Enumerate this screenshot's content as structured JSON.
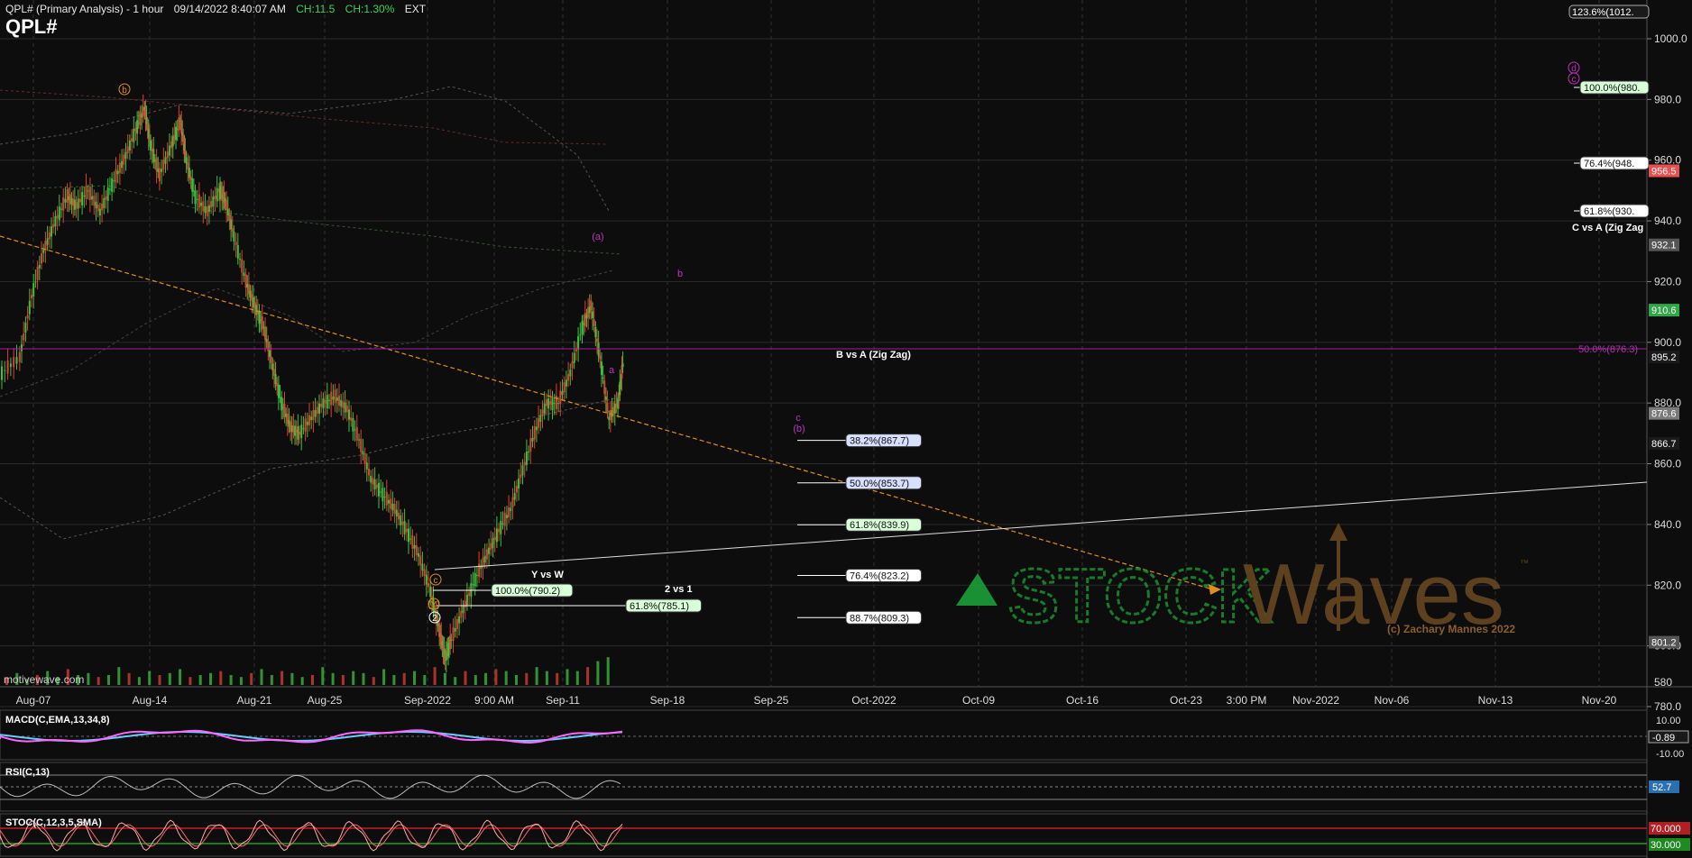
{
  "header": {
    "title": "QPL# (Primary Analysis) - 1 hour",
    "datetime": "09/14/2022 8:40:07 AM",
    "change": "CH:11.5",
    "change_pct": "CH:1.30%",
    "session": "EXT",
    "symbol": "QPL#"
  },
  "watermark": {
    "source": "motivewave.com",
    "brand_left": "STOCK",
    "brand_right": "Waves",
    "tm": "™",
    "copyright": "(c) Zachary Mannes 2022"
  },
  "colors": {
    "up": "#3fc03f",
    "down": "#e04030",
    "fib_line": "#ffffff",
    "orange": "#e0901a",
    "magenta": "#c030c0",
    "macd": "#ff66ff",
    "macd_signal": "#66ccff"
  },
  "chart_data": {
    "type": "candlestick",
    "price_axis": {
      "ticks": [
        "1000.0",
        "980.0",
        "960.0",
        "940.0",
        "920.0",
        "900.0",
        "880.0",
        "860.0",
        "840.0",
        "820.0",
        "800.0",
        "780.0",
        "580"
      ],
      "ylim": [
        771,
        1010
      ]
    },
    "price_tags": [
      {
        "text": "123.6%(1012.",
        "price": 1008,
        "color": "#1a1a1a",
        "fg": "#ffffff"
      },
      {
        "text": "956.5",
        "price": 956.5,
        "color": "#e85050",
        "fg": "#ffffff"
      },
      {
        "text": "932.1",
        "price": 932.1,
        "color": "#555555",
        "fg": "#ffffff"
      },
      {
        "text": "910.6",
        "price": 910.6,
        "color": "#2fa84a",
        "fg": "#ffffff"
      },
      {
        "text": "895.2",
        "price": 895.2,
        "color": "#1a1a1a",
        "fg": "#ffffff"
      },
      {
        "text": "876.6",
        "price": 876.6,
        "color": "#7a7a7a",
        "fg": "#ffffff"
      },
      {
        "text": "866.7",
        "price": 866.7,
        "color": "#1a1a1a",
        "fg": "#ffffff"
      },
      {
        "text": "801.2",
        "price": 801.2,
        "color": "#555555",
        "fg": "#ffffff"
      }
    ],
    "time_axis": {
      "labels": [
        "Aug-07",
        "Aug-14",
        "Aug-21",
        "Aug-25",
        "Sep-2022",
        "9:00 AM",
        "Sep-11",
        "Sep-18",
        "Sep-25",
        "Oct-2022",
        "Oct-09",
        "Oct-16",
        "Oct-23",
        "3:00 PM",
        "Nov-2022",
        "Nov-06",
        "Nov-13",
        "Nov-20"
      ]
    },
    "price_path": [
      [
        0,
        890
      ],
      [
        6,
        895
      ],
      [
        10,
        915
      ],
      [
        14,
        930
      ],
      [
        18,
        940
      ],
      [
        22,
        948
      ],
      [
        25,
        945
      ],
      [
        29,
        950
      ],
      [
        33,
        943
      ],
      [
        37,
        952
      ],
      [
        41,
        960
      ],
      [
        45,
        970
      ],
      [
        48,
        977
      ],
      [
        50,
        965
      ],
      [
        53,
        955
      ],
      [
        57,
        965
      ],
      [
        60,
        973
      ],
      [
        62,
        960
      ],
      [
        65,
        948
      ],
      [
        69,
        943
      ],
      [
        73,
        950
      ],
      [
        75,
        947
      ],
      [
        78,
        935
      ],
      [
        82,
        920
      ],
      [
        85,
        912
      ],
      [
        88,
        905
      ],
      [
        91,
        892
      ],
      [
        94,
        880
      ],
      [
        97,
        872
      ],
      [
        100,
        870
      ],
      [
        104,
        875
      ],
      [
        108,
        880
      ],
      [
        112,
        882
      ],
      [
        116,
        878
      ],
      [
        120,
        868
      ],
      [
        124,
        855
      ],
      [
        128,
        850
      ],
      [
        132,
        845
      ],
      [
        136,
        838
      ],
      [
        140,
        830
      ],
      [
        144,
        818
      ],
      [
        147,
        805
      ],
      [
        149,
        796
      ],
      [
        151,
        802
      ],
      [
        155,
        812
      ],
      [
        159,
        822
      ],
      [
        163,
        830
      ],
      [
        167,
        838
      ],
      [
        171,
        845
      ],
      [
        175,
        858
      ],
      [
        179,
        870
      ],
      [
        183,
        880
      ],
      [
        187,
        880
      ],
      [
        191,
        890
      ],
      [
        195,
        905
      ],
      [
        198,
        912
      ],
      [
        201,
        895
      ],
      [
        204,
        875
      ],
      [
        207,
        880
      ],
      [
        209,
        895
      ]
    ],
    "volume": [
      4,
      6,
      3,
      5,
      7,
      4,
      8,
      5,
      6,
      4,
      5,
      9,
      6,
      4,
      7,
      5,
      6,
      8,
      4,
      5,
      6,
      7,
      5,
      4,
      6,
      8,
      5,
      7,
      6,
      4,
      5,
      9,
      6,
      5,
      7,
      6,
      4,
      8,
      5,
      6,
      7,
      5,
      9,
      6,
      4,
      7,
      5,
      6,
      8,
      7,
      5,
      6,
      9,
      7,
      6,
      8,
      7,
      9,
      12,
      14
    ],
    "fib_levels": [
      {
        "text": "38.2%(867.7)",
        "price": 867.7,
        "color": "#d8e0ff"
      },
      {
        "text": "50.0%(853.7)",
        "price": 853.7,
        "color": "#d8e0ff"
      },
      {
        "text": "61.8%(839.9)",
        "price": 839.9,
        "color": "#d8ffd8"
      },
      {
        "text": "76.4%(823.2)",
        "price": 823.2,
        "color": "#ffffff"
      },
      {
        "text": "88.7%(809.3)",
        "price": 809.3,
        "color": "#ffffff"
      }
    ],
    "fib_upper": [
      {
        "text": "100.0%(980.",
        "price": 980,
        "color": "#d8ffd8"
      },
      {
        "text": "76.4%(948.",
        "price": 948,
        "color": "#ffffff"
      },
      {
        "text": "61.8%(930.",
        "price": 930,
        "color": "#ffffff"
      }
    ],
    "fib_lower": [
      {
        "text": "100.0%(790.2)",
        "price": 790.2,
        "color": "#d8ffd8"
      },
      {
        "text": "61.8%(785.1)",
        "price": 785.1,
        "color": "#d8ffd8"
      }
    ],
    "annotations": {
      "b_vs_a": "B vs A (Zig Zag)",
      "c_vs_a": "C vs A (Zig Zag",
      "y_vs_w": "Y vs W",
      "two_vs_one": "2 vs 1",
      "mid_fib": "50.0%(876.3)"
    },
    "wave_labels": [
      {
        "text": "b",
        "color": "#e0901a"
      },
      {
        "text": "c",
        "color": "#e0901a"
      },
      {
        "text": "(Y)",
        "color": "#e0901a"
      },
      {
        "text": "2",
        "color": "#ffffff"
      },
      {
        "text": "(a)",
        "color": "#c030c0"
      },
      {
        "text": "b",
        "color": "#c030c0"
      },
      {
        "text": "a",
        "color": "#c030c0"
      },
      {
        "text": "c",
        "color": "#c030c0"
      },
      {
        "text": "(b)",
        "color": "#c030c0"
      },
      {
        "text": "d",
        "color": "#c030c0"
      },
      {
        "text": "c",
        "color": "#c030c0"
      }
    ]
  },
  "indicators": {
    "macd": {
      "label": "MACD(C,EMA,13,34,8)",
      "ticks": [
        "10.00",
        "-10.00"
      ],
      "value": "-0.89"
    },
    "rsi": {
      "label": "RSI(C,13)",
      "value": "52.7"
    },
    "stoch": {
      "label": "STOC(C,12,3,5,SMA)",
      "ticks": [
        "70.000",
        "30.000"
      ]
    }
  }
}
